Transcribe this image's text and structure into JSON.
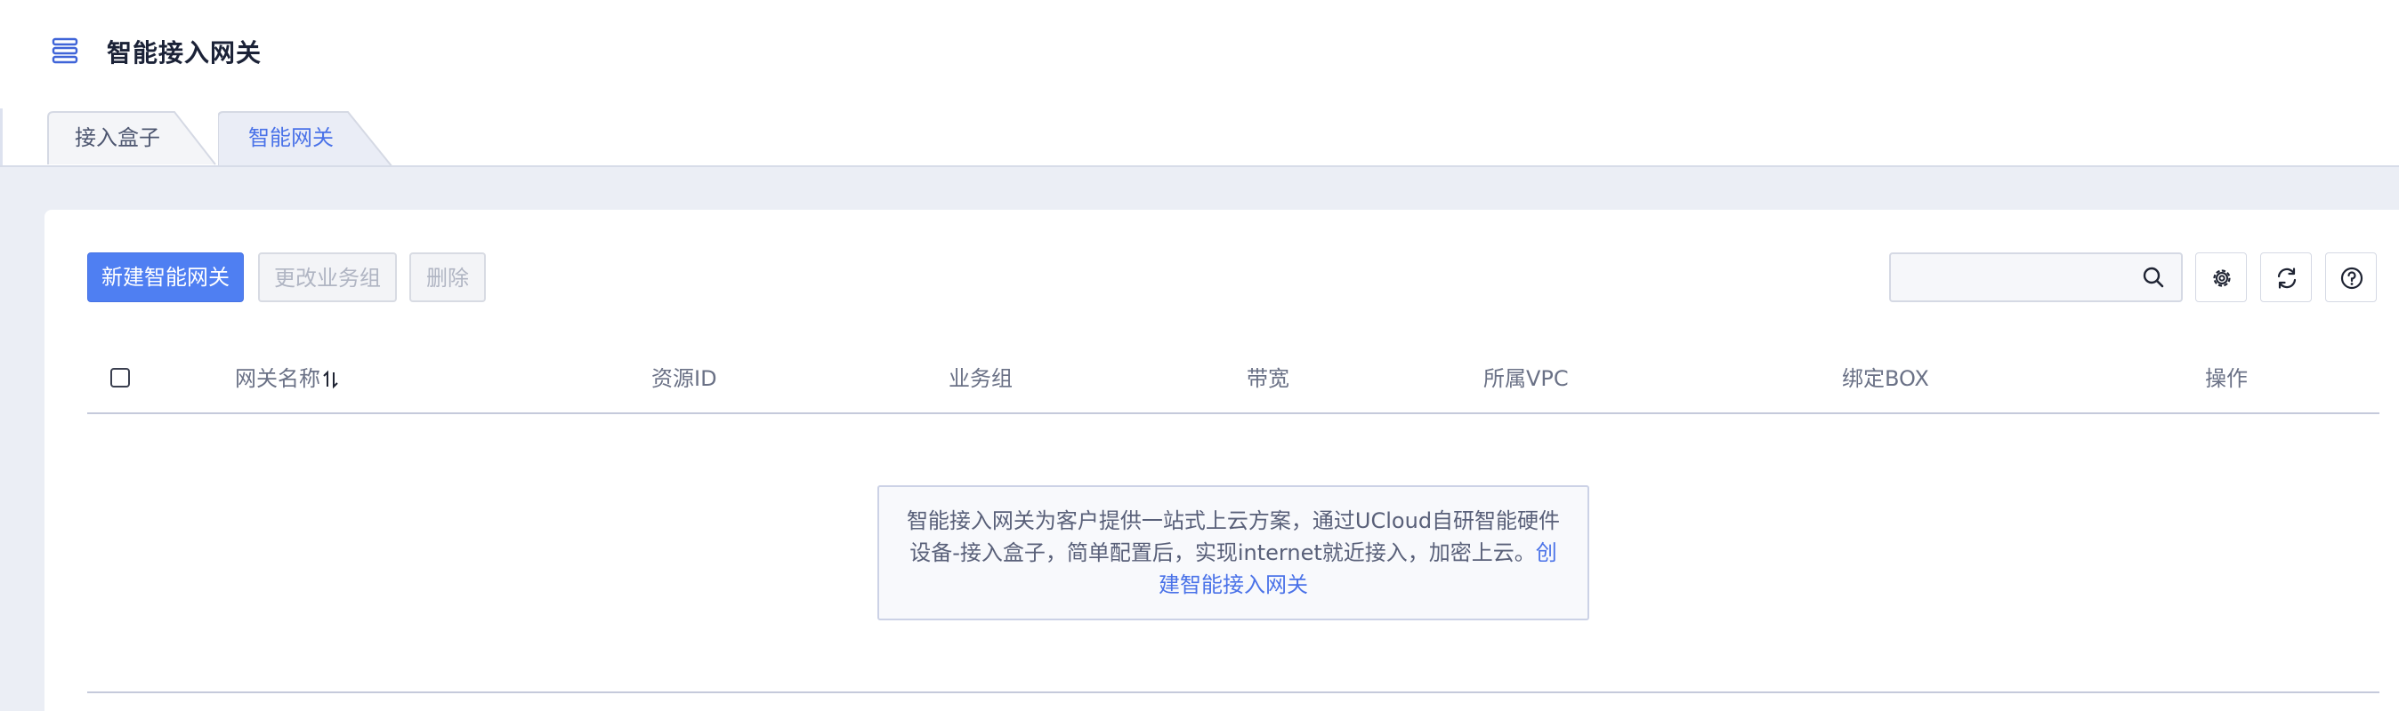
{
  "header": {
    "title": "智能接入网关",
    "menu_icon": "list-menu-icon"
  },
  "tabs": [
    {
      "label": "接入盒子",
      "active": false
    },
    {
      "label": "智能网关",
      "active": true
    }
  ],
  "toolbar": {
    "create_label": "新建智能网关",
    "change_group_label": "更改业务组",
    "delete_label": "删除",
    "search_placeholder": "",
    "search_icon": "search-icon",
    "settings_icon": "gear-icon",
    "refresh_icon": "refresh-icon",
    "help_icon": "help-icon"
  },
  "table": {
    "columns": [
      "网关名称",
      "资源ID",
      "业务组",
      "带宽",
      "所属VPC",
      "绑定BOX",
      "操作"
    ],
    "rows": []
  },
  "empty": {
    "text": "智能接入网关为客户提供一站式上云方案，通过UCloud自研智能硬件设备-接入盒子，简单配置后，实现internet就近接入，加密上云。",
    "link": "创建智能接入网关"
  },
  "colors": {
    "primary": "#4f7ff2",
    "link": "#4a72e8",
    "band": "#ebeef5"
  }
}
